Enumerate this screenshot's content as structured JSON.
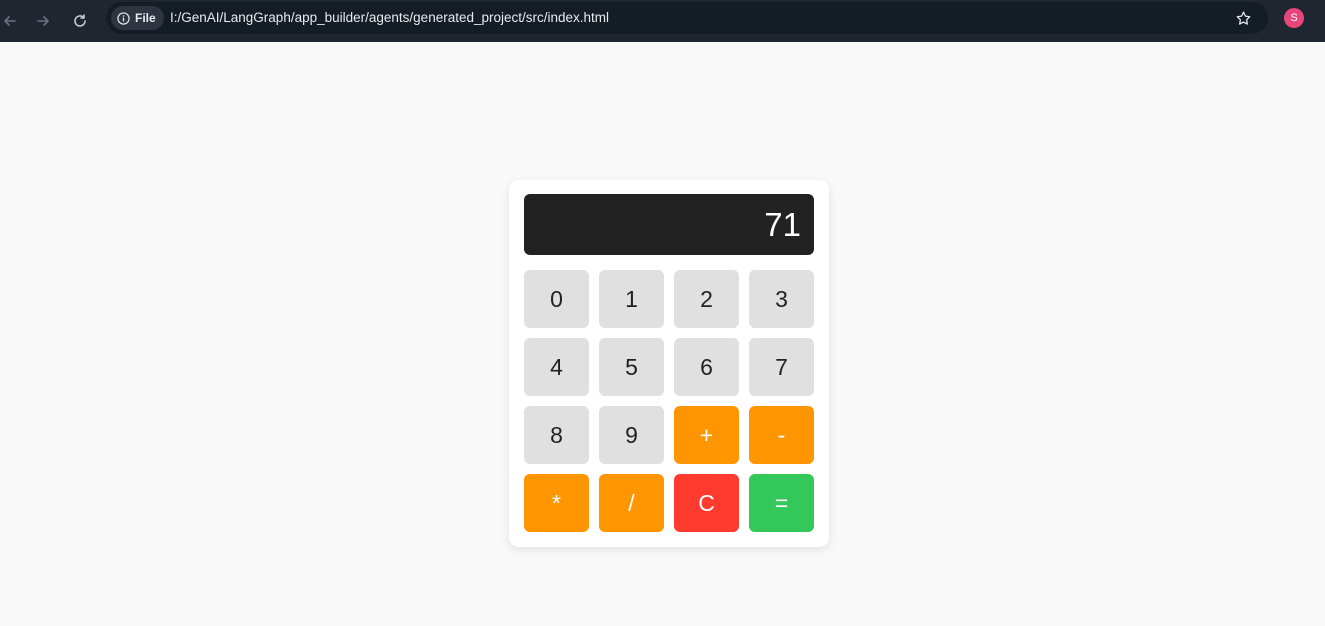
{
  "browser": {
    "file_chip_label": "File",
    "url": "I:/GenAI/LangGraph/app_builder/agents/generated_project/src/index.html",
    "avatar_initial": "S"
  },
  "calculator": {
    "display_value": "71",
    "keys": {
      "k0": "0",
      "k1": "1",
      "k2": "2",
      "k3": "3",
      "k4": "4",
      "k5": "5",
      "k6": "6",
      "k7": "7",
      "k8": "8",
      "k9": "9",
      "plus": "+",
      "minus": "-",
      "multiply": "*",
      "divide": "/",
      "clear": "C",
      "equals": "="
    }
  },
  "colors": {
    "display_bg": "#222222",
    "number_key": "#e0e0e0",
    "operator_key": "#ff9500",
    "clear_key": "#ff3b30",
    "equals_key": "#34c759",
    "avatar": "#e8457a"
  }
}
